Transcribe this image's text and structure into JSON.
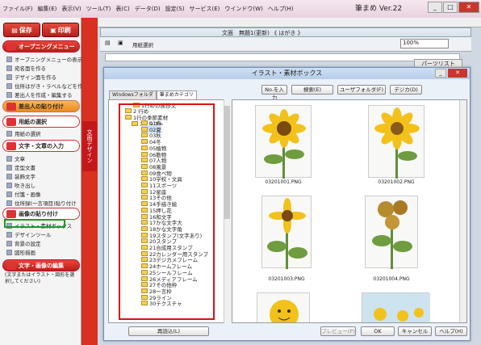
{
  "app": {
    "title": "筆まめ Ver.22"
  },
  "menubar": {
    "items": [
      "ファイル(F)",
      "編集(E)",
      "表示(V)",
      "ツール(T)",
      "表(C)",
      "データ(D)",
      "設定(S)",
      "サービス(E)",
      "ウインドウ(W)",
      "ヘルプ(H)"
    ]
  },
  "left": {
    "save": "保存",
    "print": "印刷",
    "opening": "オープニングメニュー",
    "opening_items": [
      "オープニングメニューの表示",
      "宛名面を作る",
      "デザイン面を作る",
      "住所はがき・ラベルなどを作る",
      "差出人を作成・編集する"
    ],
    "sender": "差出人の貼り付け",
    "paper": "用紙の選択",
    "paper_item": "用紙の選択",
    "text": "文字・文章の入力",
    "text_items": [
      "文章",
      "定型文書",
      "装飾文字",
      "吹き出し",
      "付箋・画像",
      "住所録(一言項目)貼り付け"
    ],
    "image": "画像の貼り付け",
    "image_items": [
      "イラスト・素材ボックス",
      "デザインツール",
      "背景の設定",
      "図形描画"
    ],
    "edit": "文字・画像の編集",
    "edit_note": "(文字またはイラスト・図形を選択してください)",
    "vtab": "文面デザイン"
  },
  "doc": {
    "title": "文面　無題1(更新) 《 はがき 》",
    "zoom": "100%",
    "tool": "用紙選択",
    "part_list": "パーツリスト"
  },
  "dialog": {
    "title": "イラスト・素材ボックス",
    "buttons": [
      "No.を入力",
      "検索(E)",
      "ユーザフォルダ(F)",
      "デジカ(D)"
    ],
    "tabs": [
      "Windowsフォルダ",
      "筆まめカテゴリ"
    ],
    "tree": [
      "1行めの挨拶文",
      "2 行め",
      "1行の季節素材",
      "1イラスト",
      "01春",
      "02夏",
      "03秋",
      "04冬",
      "05植物",
      "06動物",
      "07人物",
      "08風景",
      "09食べ物",
      "10学校・文具",
      "11スポーツ",
      "12星座",
      "13その他",
      "14手描き絵",
      "15押し花",
      "16和文字",
      "17かな文字大",
      "18かな文字角",
      "19スタンプ(文字あり)",
      "20スタンプ",
      "21合成用スタンプ",
      "22カレンダー用スタンプ",
      "23デジカメフレーム",
      "24ホームフレーム",
      "25シールフレーム",
      "26メディアフレーム",
      "27その他枠",
      "28一言枠",
      "29ライン",
      "30テクスチャ"
    ],
    "captions": [
      "03201001.PNG",
      "03201002.PNG",
      "03201003.PNG",
      "03201004.PNG"
    ],
    "bottom": {
      "reload": "再読込(L)",
      "preview": "プレビュー(P)",
      "ok": "OK",
      "cancel": "キャンセル",
      "help": "ヘルプ(H)"
    }
  },
  "colors": {
    "red": "#d9301f",
    "sun": "#f2c21b",
    "leaf": "#5f8f3a"
  }
}
